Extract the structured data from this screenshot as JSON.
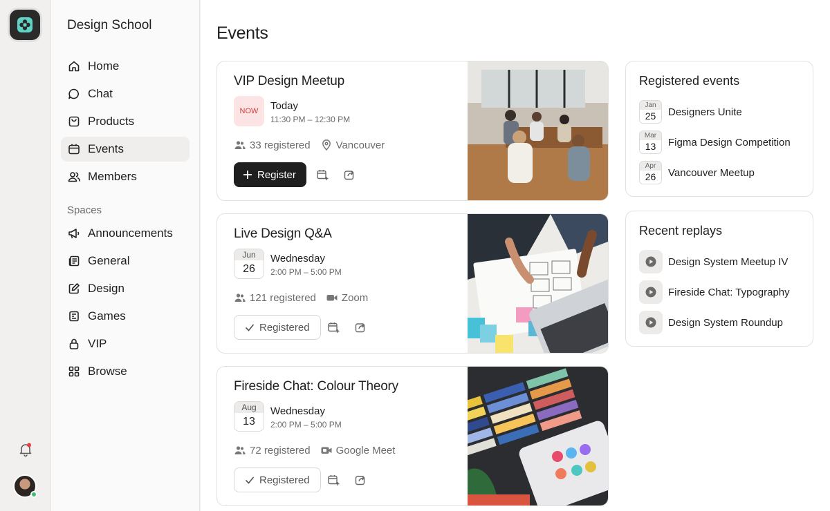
{
  "community_name": "Design School",
  "nav": [
    {
      "label": "Home",
      "icon": "home-icon"
    },
    {
      "label": "Chat",
      "icon": "chat-icon"
    },
    {
      "label": "Products",
      "icon": "bag-icon"
    },
    {
      "label": "Events",
      "icon": "calendar-icon",
      "active": true
    },
    {
      "label": "Members",
      "icon": "members-icon"
    }
  ],
  "spaces_label": "Spaces",
  "spaces": [
    {
      "label": "Announcements",
      "icon": "megaphone-icon"
    },
    {
      "label": "General",
      "icon": "newspaper-icon"
    },
    {
      "label": "Design",
      "icon": "edit-icon"
    },
    {
      "label": "Games",
      "icon": "games-icon"
    },
    {
      "label": "VIP",
      "icon": "lock-icon"
    },
    {
      "label": "Browse",
      "icon": "grid-icon"
    }
  ],
  "page_title": "Events",
  "events": [
    {
      "title": "VIP Design Meetup",
      "badge": "NOW",
      "day": "Today",
      "time": "11:30 PM – 12:30 PM",
      "registered": "33 registered",
      "location": "Vancouver",
      "action": "Register"
    },
    {
      "title": "Live Design Q&A",
      "month": "Jun",
      "date": "26",
      "day": "Wednesday",
      "time": "2:00 PM – 5:00 PM",
      "registered": "121 registered",
      "location": "Zoom",
      "action": "Registered"
    },
    {
      "title": "Fireside Chat: Colour Theory",
      "month": "Aug",
      "date": "13",
      "day": "Wednesday",
      "time": "2:00 PM – 5:00 PM",
      "registered": "72 registered",
      "location": "Google Meet",
      "action": "Registered"
    }
  ],
  "registered_panel": {
    "title": "Registered events",
    "items": [
      {
        "month": "Jan",
        "date": "25",
        "name": "Designers Unite"
      },
      {
        "month": "Mar",
        "date": "13",
        "name": "Figma Design Competition"
      },
      {
        "month": "Apr",
        "date": "26",
        "name": "Vancouver Meetup"
      }
    ]
  },
  "replays_panel": {
    "title": "Recent replays",
    "items": [
      {
        "name": "Design System Meetup IV"
      },
      {
        "name": "Fireside Chat: Typography"
      },
      {
        "name": "Design System Roundup"
      }
    ]
  },
  "colors": {
    "accent_dark": "#1f1f1f",
    "now_badge_bg": "#fde4e4",
    "now_badge_text": "#d63b3b",
    "logo_teal": "#5fd4c4",
    "online_green": "#38c172",
    "notification_red": "#e53e3e"
  }
}
